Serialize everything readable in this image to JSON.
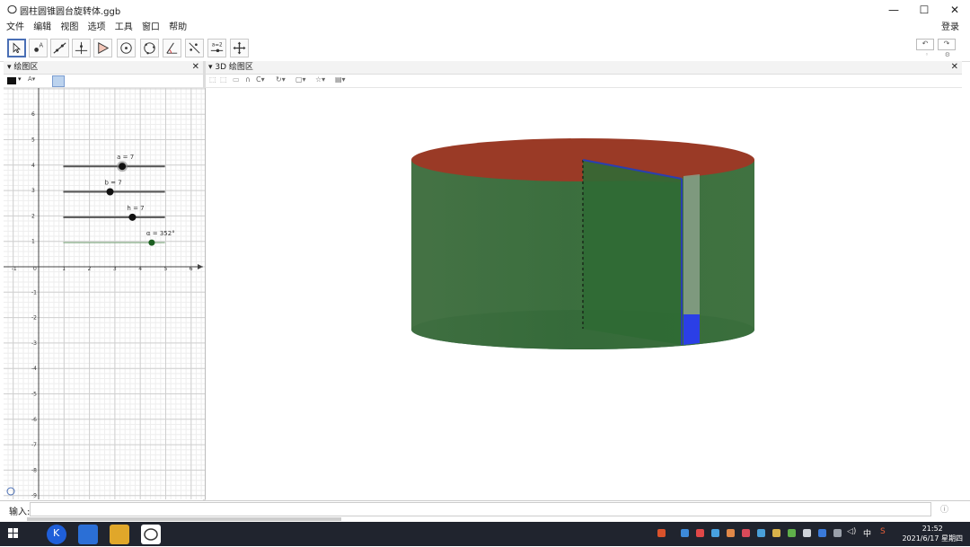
{
  "window": {
    "title": "圆柱圆锥圆台旋转体.ggb",
    "min": "—",
    "max": "☐",
    "close": "✕"
  },
  "menu": [
    "文件",
    "编辑",
    "视图",
    "选项",
    "工具",
    "窗口",
    "帮助"
  ],
  "login": "登录",
  "toolbar_tools": [
    "move-tool",
    "point-tool",
    "line-tool",
    "perpendicular-tool",
    "polygon-tool",
    "circle-tool",
    "circle-three-points-tool",
    "angle-tool",
    "reflect-tool",
    "slider-tool",
    "move-view-tool"
  ],
  "panels": {
    "left": "绘图区",
    "right": "3D 绘图区"
  },
  "sliders": [
    {
      "label": "a = 7",
      "value": 0.58
    },
    {
      "label": "b = 7",
      "value": 0.46
    },
    {
      "label": "h = 7",
      "value": 0.68
    },
    {
      "label": "α = 352°",
      "value": 0.87
    }
  ],
  "axis": {
    "x_ticks": [
      "-1",
      "0",
      "1",
      "2",
      "3",
      "4",
      "5",
      "6"
    ],
    "y_ticks": [
      "6",
      "5",
      "4",
      "3",
      "2",
      "1",
      "-1",
      "-2",
      "-3",
      "-4",
      "-5",
      "-6",
      "-7",
      "-8",
      "-9"
    ]
  },
  "input": {
    "label": "输入:"
  },
  "clock": {
    "time": "21:52",
    "date": "2021/6/17 星期四"
  },
  "tray_text": [
    "中",
    "S"
  ]
}
